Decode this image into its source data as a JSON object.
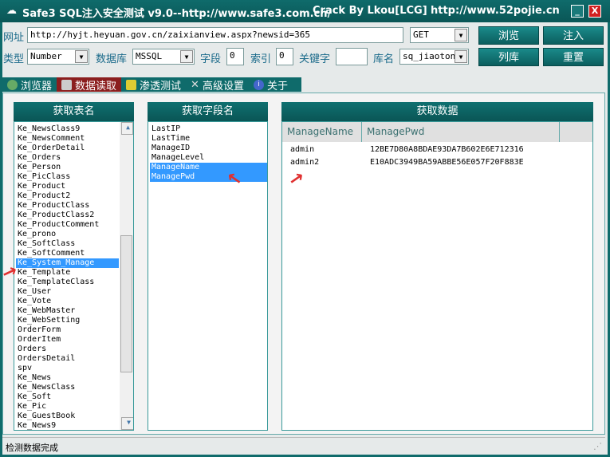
{
  "title": {
    "app": "Safe3 SQL注入安全测试 v9.0--http://www.safe3.com.cn/",
    "crack": "Crack  By  Lkou[LCG]",
    "site": "http://www.52pojie.cn",
    "min": "_",
    "close": "X"
  },
  "toolbar": {
    "url_label": "网址",
    "url": "http://hyjt.heyuan.gov.cn/zaixianview.aspx?newsid=365",
    "method": "GET",
    "browse": "浏览",
    "inject": "注入",
    "type_label": "类型",
    "type": "Number",
    "db_label": "数据库",
    "db": "MSSQL",
    "field_label": "字段",
    "field": "0",
    "index_label": "索引",
    "index": "0",
    "keyword_label": "关键字",
    "keyword": "",
    "dbname_label": "库名",
    "dbname": "sq_jiaotong",
    "list_db": "列库",
    "reset": "重置"
  },
  "tabs": [
    "浏览器",
    "数据读取",
    "渗透测试",
    "高级设置",
    "关于"
  ],
  "tables": {
    "header": "获取表名",
    "items": [
      "Ke_NewsClass9",
      "Ke_NewsComment",
      "Ke_OrderDetail",
      "Ke_Orders",
      "Ke_Person",
      "Ke_PicClass",
      "Ke_Product",
      "Ke_Product2",
      "Ke_ProductClass",
      "Ke_ProductClass2",
      "Ke_ProductComment",
      "Ke_prono",
      "Ke_SoftClass",
      "Ke_SoftComment",
      "Ke_System_Manage",
      "Ke_Template",
      "Ke_TemplateClass",
      "Ke_User",
      "Ke_Vote",
      "Ke_WebMaster",
      "Ke_WebSetting",
      "OrderForm",
      "OrderItem",
      "Orders",
      "OrdersDetail",
      "spv",
      "Ke_News",
      "Ke_NewsClass",
      "Ke_Soft",
      "Ke_Pic",
      "Ke_GuestBook",
      "Ke_News9"
    ],
    "selected": 14
  },
  "fields": {
    "header": "获取字段名",
    "items": [
      "LastIP",
      "LastTime",
      "ManageID",
      "ManageLevel",
      "ManageName",
      "ManagePwd"
    ],
    "selected": [
      4,
      5
    ]
  },
  "data": {
    "header": "获取数据",
    "columns": [
      "ManageName",
      "ManagePwd"
    ],
    "rows": [
      [
        "admin",
        "12BE7D80A8BDAE93DA7B602E6E712316"
      ],
      [
        "admin2",
        "E10ADC3949BA59ABBE56E057F20F883E"
      ]
    ]
  },
  "status": "检测数据完成"
}
